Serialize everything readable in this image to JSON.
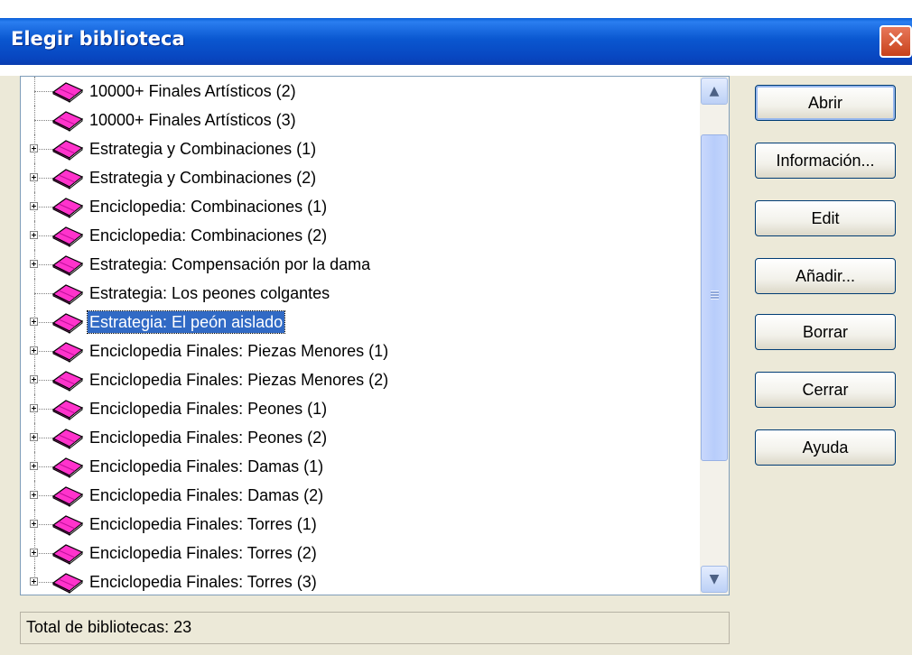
{
  "window": {
    "title": "Elegir biblioteca",
    "close_glyph": "✕"
  },
  "colors": {
    "titlebar": "#0a57d0",
    "selection": "#316ac5",
    "book_pink": "#ff33cc",
    "dialog_bg": "#ece9d8"
  },
  "tree": {
    "items": [
      {
        "label": "10000+ Finales Artísticos (2)",
        "expandable": false,
        "selected": false
      },
      {
        "label": "10000+ Finales Artísticos (3)",
        "expandable": false,
        "selected": false
      },
      {
        "label": "Estrategia y Combinaciones (1)",
        "expandable": true,
        "selected": false
      },
      {
        "label": "Estrategia y Combinaciones (2)",
        "expandable": true,
        "selected": false
      },
      {
        "label": "Enciclopedia: Combinaciones (1)",
        "expandable": true,
        "selected": false
      },
      {
        "label": "Enciclopedia: Combinaciones (2)",
        "expandable": true,
        "selected": false
      },
      {
        "label": "Estrategia: Compensación por la dama",
        "expandable": true,
        "selected": false
      },
      {
        "label": "Estrategia: Los peones colgantes",
        "expandable": false,
        "selected": false
      },
      {
        "label": "Estrategia: El peón aislado",
        "expandable": true,
        "selected": true
      },
      {
        "label": "Enciclopedia Finales: Piezas Menores (1)",
        "expandable": true,
        "selected": false
      },
      {
        "label": "Enciclopedia Finales: Piezas Menores (2)",
        "expandable": true,
        "selected": false
      },
      {
        "label": "Enciclopedia Finales: Peones (1)",
        "expandable": true,
        "selected": false
      },
      {
        "label": "Enciclopedia Finales: Peones (2)",
        "expandable": true,
        "selected": false
      },
      {
        "label": "Enciclopedia Finales: Damas (1)",
        "expandable": true,
        "selected": false
      },
      {
        "label": "Enciclopedia Finales: Damas (2)",
        "expandable": true,
        "selected": false
      },
      {
        "label": "Enciclopedia Finales: Torres (1)",
        "expandable": true,
        "selected": false
      },
      {
        "label": "Enciclopedia Finales: Torres (2)",
        "expandable": true,
        "selected": false
      },
      {
        "label": "Enciclopedia Finales: Torres (3)",
        "expandable": true,
        "selected": false
      }
    ]
  },
  "buttons": {
    "open": "Abrir",
    "info": "Información...",
    "edit": "Edit",
    "add": "Añadir...",
    "delete": "Borrar",
    "close": "Cerrar",
    "help": "Ayuda"
  },
  "status": {
    "text": "Total de bibliotecas: 23"
  }
}
